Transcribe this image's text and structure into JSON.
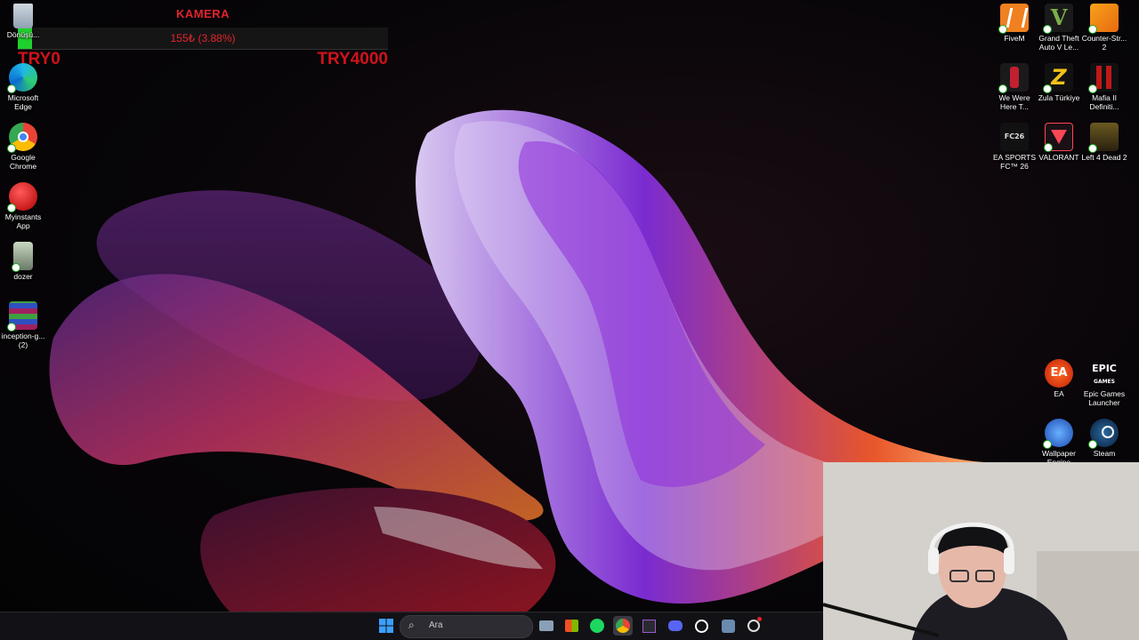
{
  "overlay": {
    "title": "KAMERA",
    "progress_text": "155₺ (3.88%)",
    "progress_fraction": 0.0388,
    "min_label": "TRY0",
    "max_label": "TRY4000"
  },
  "desktop_left": [
    {
      "label": "Dönüşü...",
      "icon": "recycle-bin-icon"
    },
    {
      "label": "Microsoft Edge",
      "icon": "edge-icon"
    },
    {
      "label": "Google Chrome",
      "icon": "chrome-icon"
    },
    {
      "label": "Myinstants App",
      "icon": "myinstants-icon"
    },
    {
      "label": "dozer",
      "icon": "dozer-icon"
    },
    {
      "label": "inception-g... (2)",
      "icon": "winrar-icon"
    }
  ],
  "desktop_right": [
    {
      "label": "FiveM",
      "icon": "fivem-icon"
    },
    {
      "label": "Grand Theft Auto V Le...",
      "icon": "gta-icon"
    },
    {
      "label": "Counter-Str... 2",
      "icon": "cs2-icon"
    },
    {
      "label": "We Were Here T...",
      "icon": "we-were-here-icon"
    },
    {
      "label": "Zula Türkiye",
      "icon": "zula-icon"
    },
    {
      "label": "Mafia II Definiti...",
      "icon": "mafia-icon"
    },
    {
      "label": "EA SPORTS FC™ 26",
      "icon": "fc26-icon"
    },
    {
      "label": "VALORANT",
      "icon": "valorant-icon"
    },
    {
      "label": "Left 4 Dead 2",
      "icon": "l4d2-icon"
    },
    {
      "label": "EA",
      "icon": "ea-icon"
    },
    {
      "label": "Epic Games Launcher",
      "icon": "epic-icon"
    },
    {
      "label": "Wallpaper Engine",
      "icon": "wallpaper-engine-icon"
    },
    {
      "label": "Steam",
      "icon": "steam-icon"
    }
  ],
  "icon_text": {
    "epic": "EPIC",
    "epic_sub": "GAMES",
    "ea": "EA",
    "fc_logo": "FC26"
  },
  "taskbar": {
    "search_placeholder": "Ara",
    "apps": [
      "start-icon",
      "search-icon",
      "file-explorer-icon",
      "microsoft-store-icon",
      "spotify-icon",
      "chrome-icon",
      "visual-studio-icon",
      "discord-icon",
      "whatsapp-icon",
      "steam-taskbar-icon",
      "settings-icon"
    ]
  },
  "colors": {
    "accent_red": "#d0121a",
    "progress_green": "#1fd12c"
  }
}
